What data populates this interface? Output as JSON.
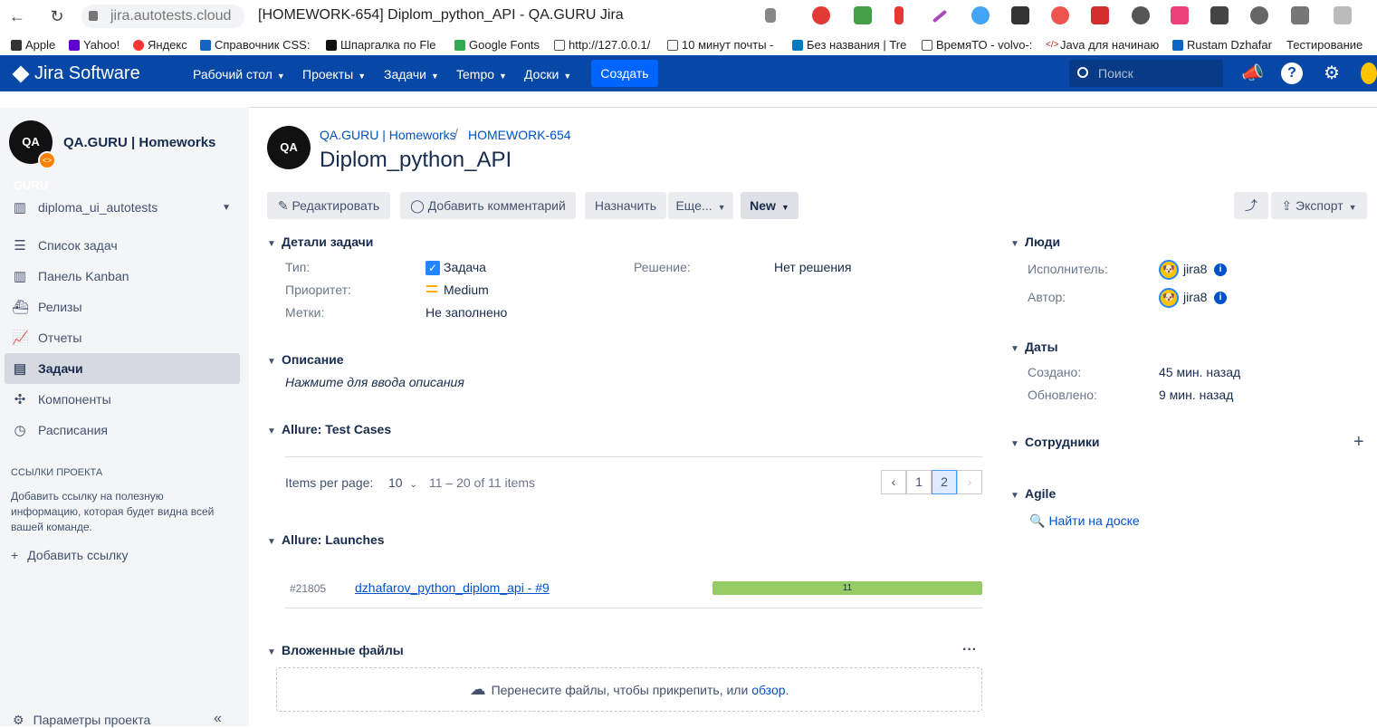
{
  "browser": {
    "url": "jira.autotests.cloud",
    "tab_title": "[HOMEWORK-654] Diplom_python_API - QA.GURU Jira",
    "bookmarks": [
      "Apple",
      "Yahoo!",
      "Яндекс",
      "Справочник CSS:",
      "Шпаргалка по Fle",
      "Google Fonts",
      "http://127.0.0.1/",
      "10 минут почты -",
      "Без названия | Tre",
      "ВремяТО - volvo-:",
      "Java для начинаю",
      "Rustam Dzhafar",
      "Тестирование"
    ]
  },
  "header": {
    "logo": "Jira Software",
    "nav": [
      "Рабочий стол",
      "Проекты",
      "Задачи",
      "Tempo",
      "Доски"
    ],
    "create": "Создать",
    "search_placeholder": "Поиск"
  },
  "sidebar": {
    "project_name": "QA.GURU | Homeworks",
    "avatar_text": "QA GURU",
    "board": "diploma_ui_autotests",
    "items": [
      {
        "label": "Список задач",
        "icon": "backlog-icon"
      },
      {
        "label": "Панель Kanban",
        "icon": "board-icon"
      },
      {
        "label": "Релизы",
        "icon": "ship-icon"
      },
      {
        "label": "Отчеты",
        "icon": "chart-icon"
      },
      {
        "label": "Задачи",
        "icon": "issues-icon"
      },
      {
        "label": "Компоненты",
        "icon": "puzzle-icon"
      },
      {
        "label": "Расписания",
        "icon": "clock-icon"
      }
    ],
    "links_heading": "ССЫЛКИ ПРОЕКТА",
    "links_text": "Добавить ссылку на полезную информацию, которая будет видна всей вашей команде.",
    "add_link": "Добавить ссылку",
    "settings": "Параметры проекта"
  },
  "issue": {
    "breadcrumb_project": "QA.GURU | Homeworks",
    "breadcrumb_key": "HOMEWORK-654",
    "summary": "Diplom_python_API",
    "buttons": {
      "edit": "Редактировать",
      "comment": "Добавить комментарий",
      "assign": "Назначить",
      "more": "Еще...",
      "status": "New",
      "export": "Экспорт"
    },
    "details": {
      "heading": "Детали задачи",
      "type_label": "Тип:",
      "type_value": "Задача",
      "priority_label": "Приоритет:",
      "priority_value": "Medium",
      "labels_label": "Метки:",
      "labels_value": "Не заполнено",
      "resolution_label": "Решение:",
      "resolution_value": "Нет решения"
    },
    "description": {
      "heading": "Описание",
      "placeholder": "Нажмите для ввода описания"
    },
    "test_cases": {
      "heading": "Allure: Test Cases",
      "items_per_page_label": "Items per page:",
      "items_per_page_value": "10",
      "range": "11 – 20 of 11 items",
      "pages": [
        "1",
        "2"
      ]
    },
    "launches": {
      "heading": "Allure: Launches",
      "id": "#21805",
      "name": "dzhafarov_python_diplom_api - #9",
      "passed": "11"
    },
    "attachments": {
      "heading": "Вложенные файлы",
      "drop_text": "Перенесите файлы, чтобы прикрепить, или",
      "browse": "обзор",
      "period": "."
    }
  },
  "right": {
    "people": {
      "heading": "Люди",
      "assignee_label": "Исполнитель:",
      "assignee": "jira8",
      "reporter_label": "Автор:",
      "reporter": "jira8"
    },
    "dates": {
      "heading": "Даты",
      "created_label": "Создано:",
      "created": "45 мин. назад",
      "updated_label": "Обновлено:",
      "updated": "9 мин. назад"
    },
    "staff": {
      "heading": "Сотрудники"
    },
    "agile": {
      "heading": "Agile",
      "find": "Найти на доске"
    }
  }
}
